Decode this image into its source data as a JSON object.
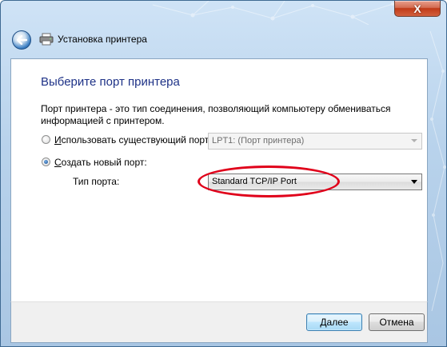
{
  "window": {
    "title": "Установка принтера",
    "close_label": "X"
  },
  "page": {
    "heading": "Выберите порт принтера",
    "description": "Порт принтера - это тип соединения, позволяющий компьютеру обмениваться информацией с принтером."
  },
  "existing_port": {
    "label_prefix": "",
    "label_underlined": "И",
    "label_rest": "спользовать существующий порт:",
    "selected": false,
    "value": "LPT1: (Порт принтера)"
  },
  "new_port": {
    "label_prefix": "",
    "label_underlined": "С",
    "label_rest": "оздать новый порт:",
    "selected": true,
    "type_label": "Тип порта:",
    "type_value": "Standard TCP/IP Port"
  },
  "buttons": {
    "next_label": "Далее",
    "cancel_label": "Отмена"
  },
  "colors": {
    "heading": "#1e3287",
    "highlight": "#e0001a",
    "titlebar": "#b9d3ec"
  }
}
